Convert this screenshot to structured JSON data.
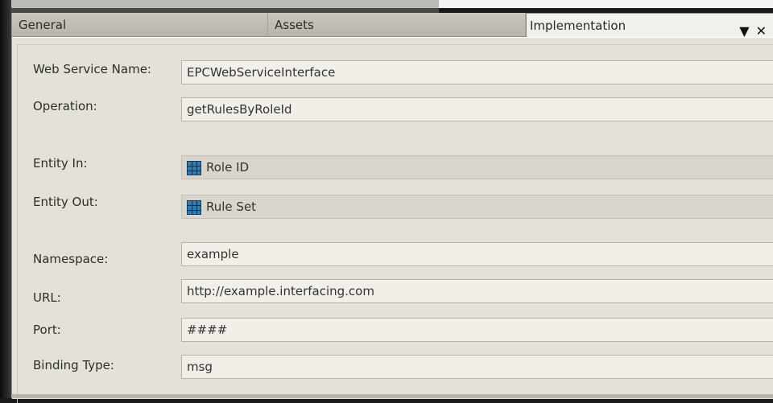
{
  "tabs": [
    {
      "label": "General"
    },
    {
      "label": "Assets"
    },
    {
      "label": "Implementation"
    }
  ],
  "tab_actions": {
    "pin_icon": "pin-icon",
    "close_icon": "close-icon"
  },
  "form": {
    "web_service_name": {
      "label": "Web Service Name:",
      "value": "EPCWebServiceInterface"
    },
    "operation": {
      "label": "Operation:",
      "value": "getRulesByRoleId"
    },
    "entity_in": {
      "label": "Entity In:",
      "value": "Role ID",
      "icon": "entity-icon"
    },
    "entity_out": {
      "label": "Entity Out:",
      "value": "Rule Set",
      "icon": "entity-icon"
    },
    "namespace": {
      "label": "Namespace:",
      "value": "example"
    },
    "url": {
      "label": "URL:",
      "value": "http://example.interfacing.com"
    },
    "port": {
      "label": "Port:",
      "value": "####"
    },
    "binding_type": {
      "label": "Binding Type:",
      "value": "msg"
    }
  }
}
